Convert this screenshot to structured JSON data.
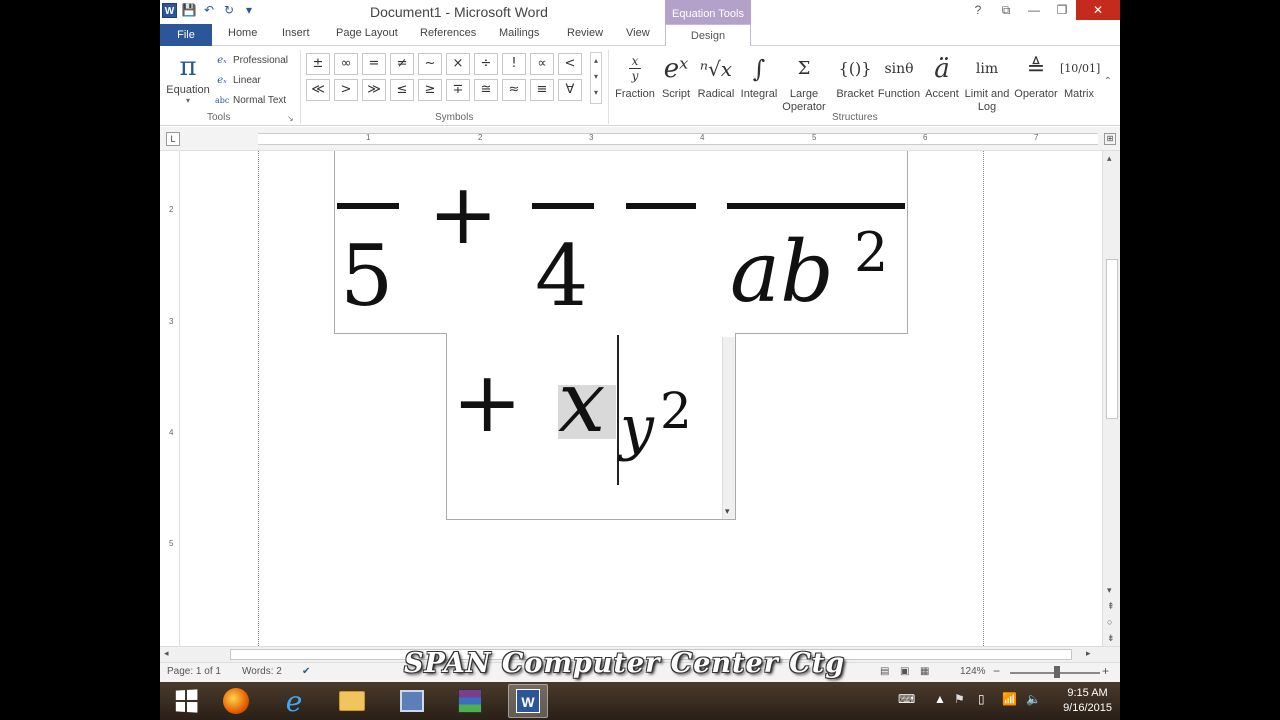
{
  "window": {
    "title": "Document1 - Microsoft Word",
    "context_group": "Equation Tools",
    "controls": {
      "help": "?",
      "restore_ribbon": "⧉",
      "minimize": "—",
      "maximize": "❐",
      "close": "✕"
    }
  },
  "qat": {
    "logo": "W",
    "save": "💾",
    "undo": "↶",
    "redo": "↻",
    "customize": "▾"
  },
  "tabs": [
    {
      "label": "File"
    },
    {
      "label": "Home"
    },
    {
      "label": "Insert"
    },
    {
      "label": "Page Layout"
    },
    {
      "label": "References"
    },
    {
      "label": "Mailings"
    },
    {
      "label": "Review"
    },
    {
      "label": "View"
    },
    {
      "label": "Design"
    }
  ],
  "ribbon": {
    "tools": {
      "group_label": "Tools",
      "equation_label": "Equation",
      "equation_glyph": "π",
      "items": [
        {
          "label": "Professional",
          "icon": "eₓ"
        },
        {
          "label": "Linear",
          "icon": "eₓ"
        },
        {
          "label": "Normal Text",
          "icon": "abc"
        }
      ]
    },
    "symbols": {
      "group_label": "Symbols",
      "items": [
        "±",
        "∞",
        "=",
        "≠",
        "~",
        "×",
        "÷",
        "!",
        "∝",
        "<",
        "≪",
        ">",
        "≫",
        "≤",
        "≥",
        "∓",
        "≅",
        "≈",
        "≡",
        "∀"
      ]
    },
    "structures": {
      "group_label": "Structures",
      "items": [
        {
          "label": "Fraction",
          "glyph": "x/y"
        },
        {
          "label": "Script",
          "glyph": "eˣ"
        },
        {
          "label": "Radical",
          "glyph": "ⁿ√x"
        },
        {
          "label": "Integral",
          "glyph": "∫"
        },
        {
          "label": "Large Operator",
          "glyph": "Σ"
        },
        {
          "label": "Bracket",
          "glyph": "{()}"
        },
        {
          "label": "Function",
          "glyph": "sinθ"
        },
        {
          "label": "Accent",
          "glyph": "ä"
        },
        {
          "label": "Limit and Log",
          "glyph": "lim"
        },
        {
          "label": "Operator",
          "glyph": "≜"
        },
        {
          "label": "Matrix",
          "glyph": "[10/01]"
        }
      ]
    }
  },
  "ruler": {
    "numbers": [
      "1",
      "2",
      "3",
      "4",
      "5",
      "6",
      "7"
    ]
  },
  "vruler": {
    "numbers": [
      "2",
      "3",
      "4",
      "5"
    ]
  },
  "equation": {
    "frac1_den": "5",
    "plus1": "+",
    "frac2_den": "4",
    "minus": "−",
    "frac3_den": "ab",
    "frac3_den_sup": "2",
    "plus2": "+",
    "var_x": "x",
    "sub_y": "y",
    "sup_2": "2"
  },
  "status": {
    "page": "Page: 1 of 1",
    "words": "Words: 2",
    "zoom": "124%",
    "zoom_minus": "−",
    "zoom_plus": "+"
  },
  "watermark": "SPAN Computer Center Ctg",
  "taskbar": {
    "time": "9:15 AM",
    "date": "9/16/2015"
  }
}
